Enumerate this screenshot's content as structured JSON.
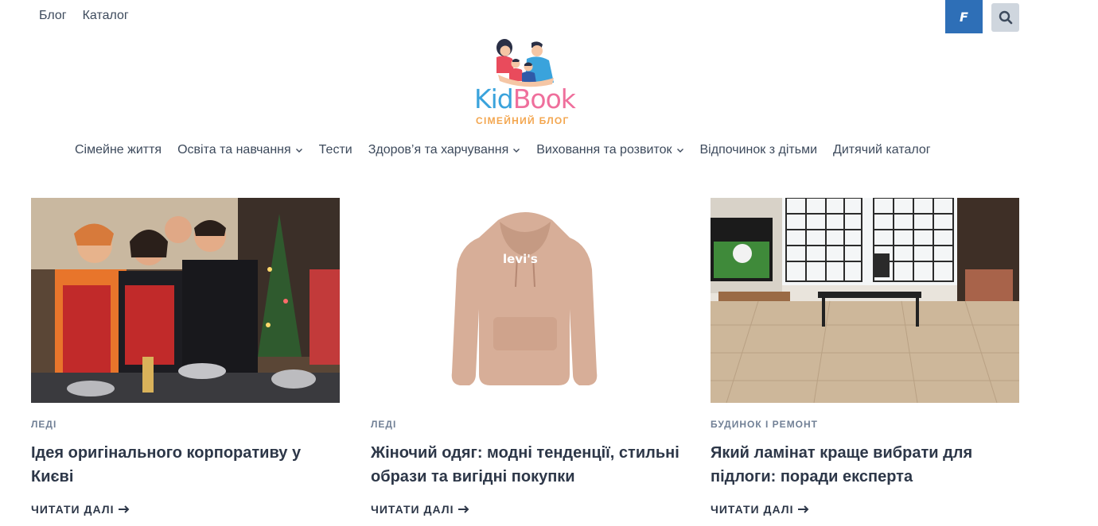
{
  "top_nav": [
    "Блог",
    "Каталог"
  ],
  "header_buttons": {
    "f_label": "F"
  },
  "logo": {
    "part1": "Kid",
    "part2": "Book",
    "subtitle": "СІМЕЙНИЙ БЛОГ"
  },
  "main_nav": [
    {
      "label": "Сімейне життя"
    },
    {
      "label": "Освіта та навчання"
    },
    {
      "label": "Тести"
    },
    {
      "label": "Здоров’я та харчування"
    },
    {
      "label": "Виховання та розвиток"
    },
    {
      "label": "Відпочинок з дітьми"
    },
    {
      "label": "Дитячий каталог"
    }
  ],
  "articles": [
    {
      "category": "ЛЕДІ",
      "title": "Ідея оригінального корпоративу у Києві",
      "read_more": "ЧИТАТИ ДАЛІ"
    },
    {
      "category": "ЛЕДІ",
      "title": "Жіночий одяг: модні тенденції, стильні образи та вигідні покупки",
      "read_more": "ЧИТАТИ ДАЛІ",
      "image_text": "levi's"
    },
    {
      "category": "БУДИНОК І РЕМОНТ",
      "title": "Який ламінат краще вибрати для підлоги: поради експерта",
      "read_more": "ЧИТАТИ ДАЛІ"
    }
  ],
  "colors": {
    "facebook": "#2e6fb7",
    "search_bg": "#cfd6de",
    "logo_blue": "#3aa3dc",
    "logo_pink": "#ef6f9c",
    "logo_orange": "#f3a64f"
  }
}
